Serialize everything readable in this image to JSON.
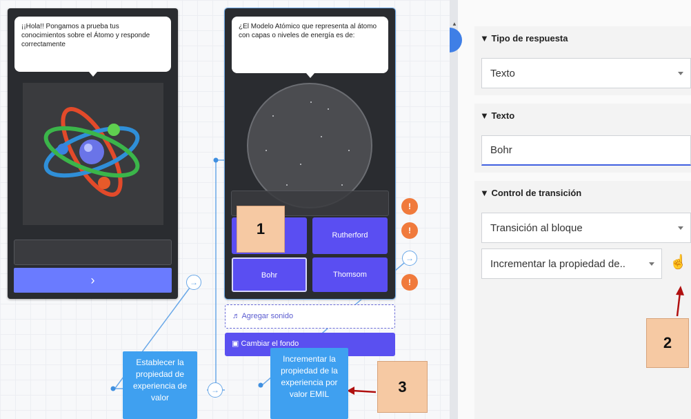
{
  "editor": {
    "screen1": {
      "bubble_text": "¡¡Hola!! Pongamos a prueba tus conocimientos sobre el Átomo y responde correctamente",
      "next_glyph": "›"
    },
    "screen2": {
      "bubble_text": "¿El Modelo Atómico que representa al átomo con capas o niveles de energía es de:",
      "answers": [
        "",
        "Rutherford",
        "Bohr",
        "Thomsom"
      ],
      "warn_glyph": "!",
      "add_sound": "Agregar sonido",
      "change_bg": "Cambiar el fondo"
    },
    "actions": {
      "set_property": "Establecer la propiedad de experiencia de valor",
      "increment_property": "Incrementar la propiedad de la experiencia por valor EMIL"
    },
    "annotations": [
      "1",
      "2",
      "3"
    ],
    "arrow_glyph": "→"
  },
  "panel": {
    "sections": [
      {
        "title": "▼ Tipo de respuesta",
        "field": "Texto"
      },
      {
        "title": "▼ Texto",
        "field": "Bohr"
      },
      {
        "title": "▼ Control de transición",
        "field": "Transición al bloque",
        "field2": "Incrementar la propiedad de.."
      }
    ]
  },
  "colors": {
    "accent": "#5a4ef2",
    "warning": "#f07a3c",
    "action": "#3fa0f0",
    "annotation": "#f6c9a3",
    "marker": "#b01010"
  }
}
